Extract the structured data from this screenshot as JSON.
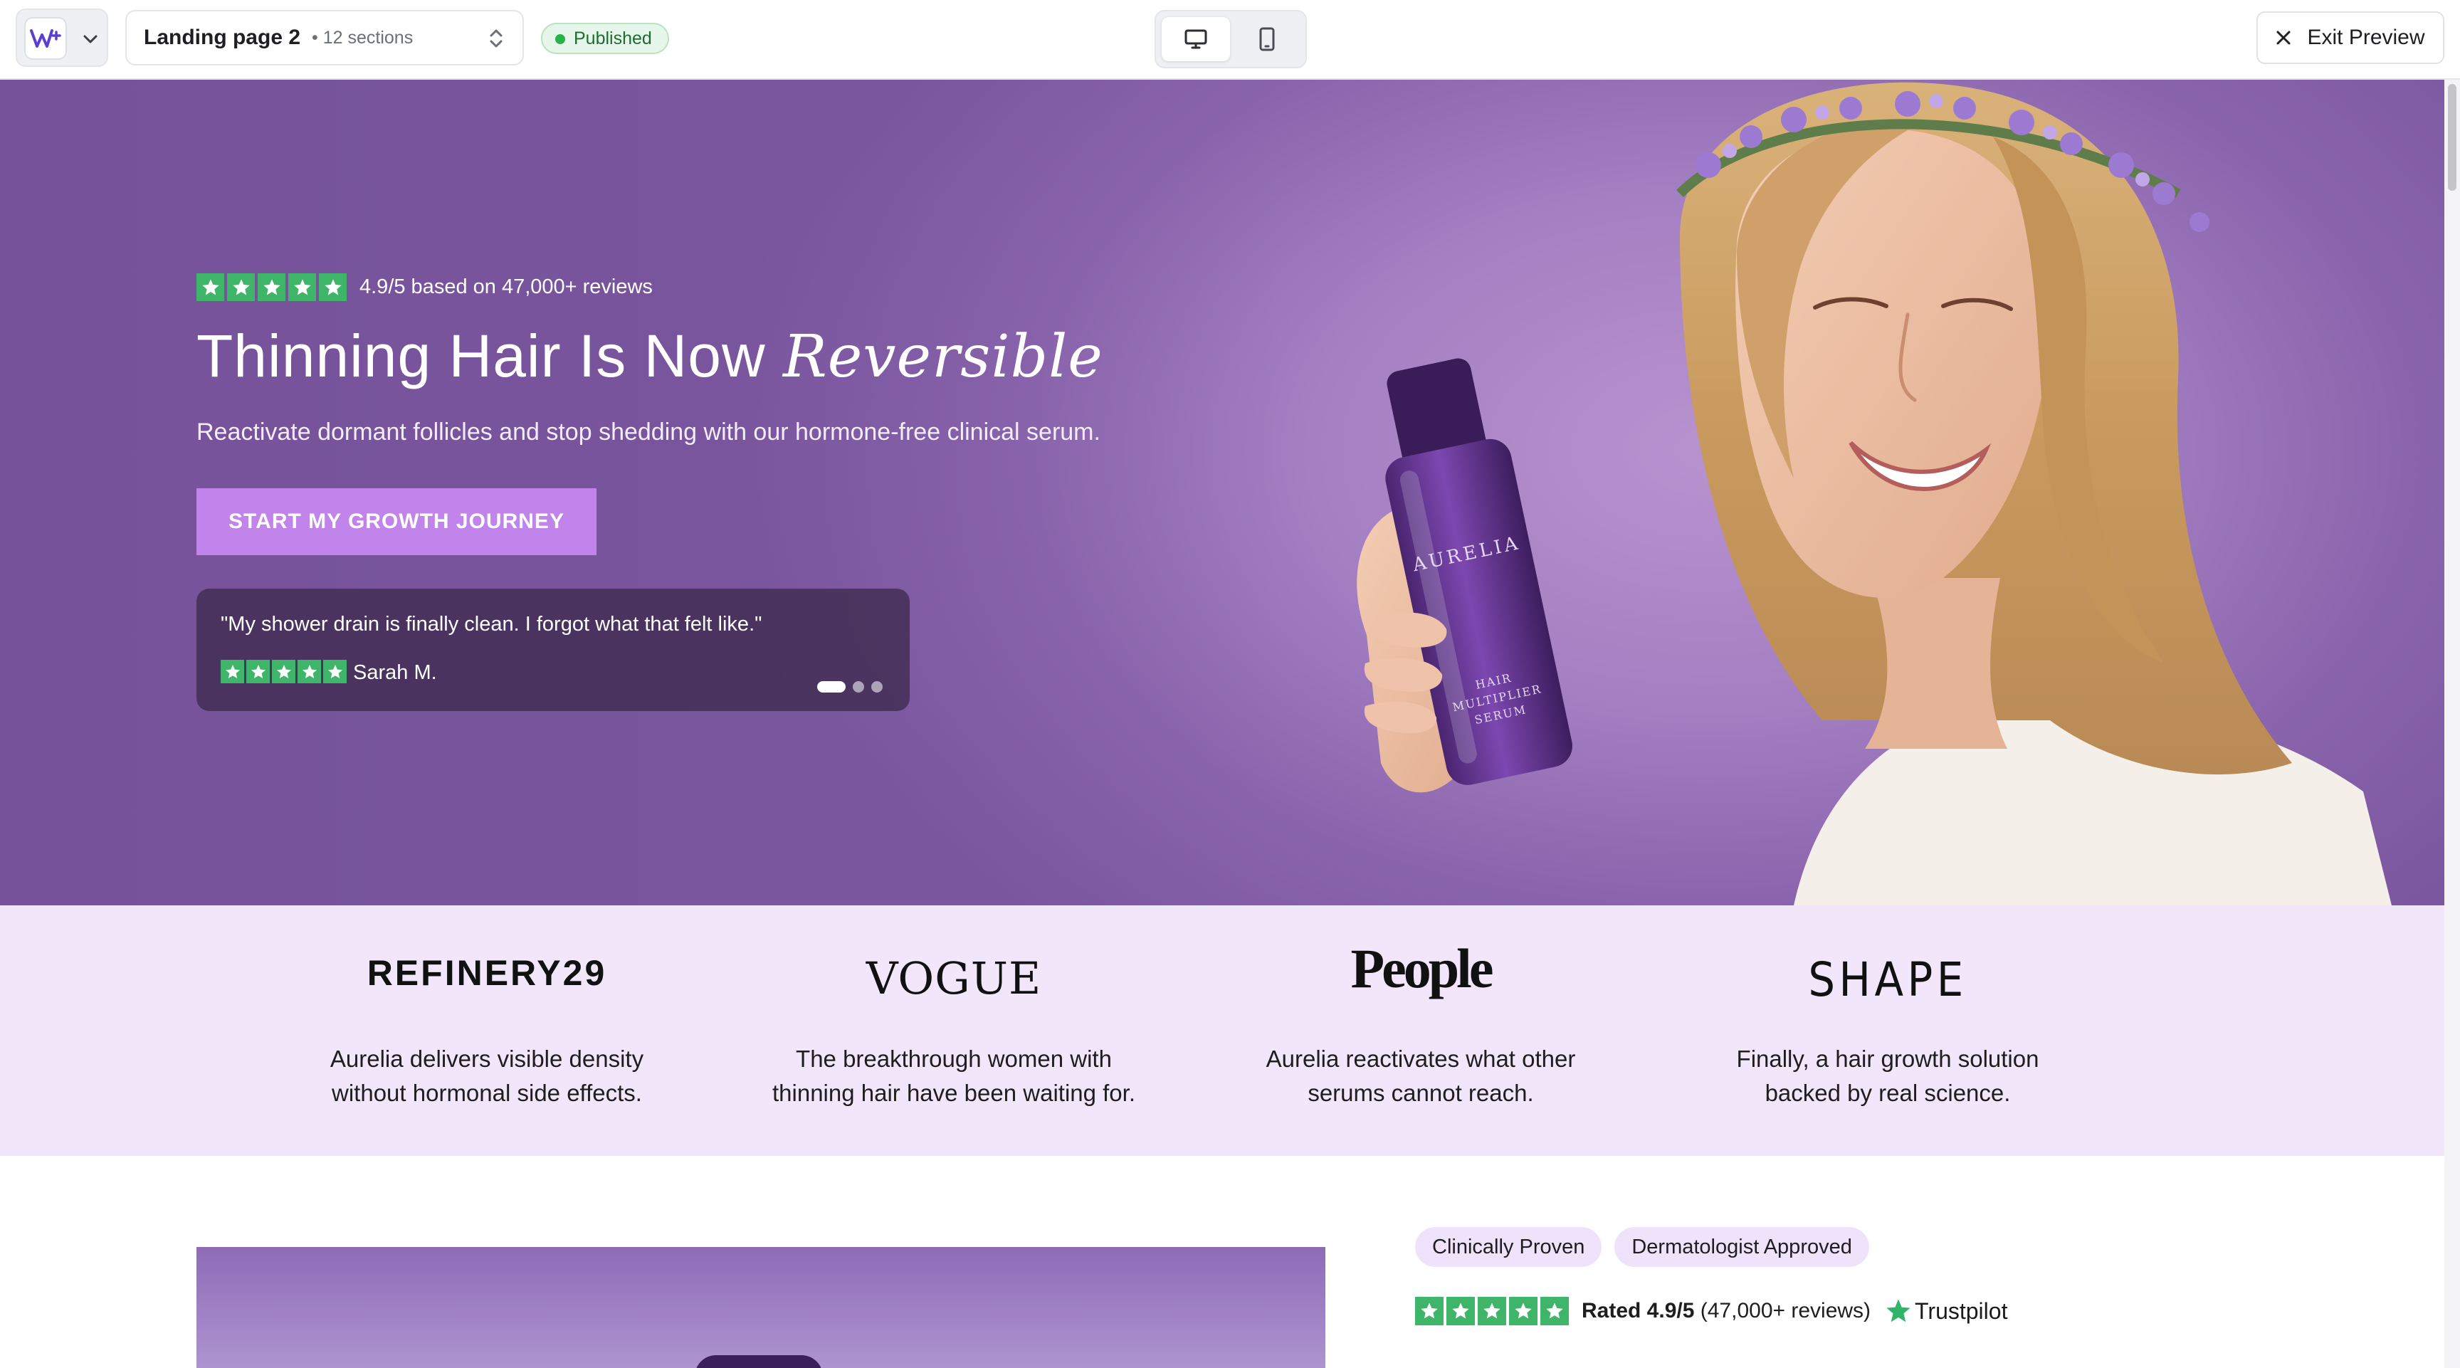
{
  "editor": {
    "page_name": "Landing page 2",
    "sections_count": "• 12 sections",
    "status": "Published",
    "exit_label": "Exit Preview",
    "devices": [
      "desktop-icon",
      "mobile-icon"
    ],
    "active_device": "desktop"
  },
  "hero": {
    "rating_text": "4.9/5 based on 47,000+ reviews",
    "title_main": "Thinning Hair Is Now ",
    "title_accent": "Reversible",
    "subtitle": "Reactivate dormant follicles and stop shedding with our hormone-free clinical serum.",
    "cta_label": "START MY GROWTH JOURNEY",
    "testimonial": {
      "quote": "\"My shower drain is finally clean. I forgot what that felt like.\"",
      "author": "Sarah M.",
      "slide_count": 3,
      "active_slide": 1
    },
    "product_brand": "AURELIA",
    "product_label_1": "HAIR",
    "product_label_2": "MULTIPLIER",
    "product_label_3": "SERUM"
  },
  "press": [
    {
      "logo": "REFINERY29",
      "quote_1": "Aurelia delivers visible density",
      "quote_2": "without hormonal side effects."
    },
    {
      "logo": "VOGUE",
      "quote_1": "The breakthrough women with",
      "quote_2": "thinning hair have been waiting for."
    },
    {
      "logo": "People",
      "quote_1": "Aurelia reactivates what other",
      "quote_2": "serums cannot reach."
    },
    {
      "logo": "SHAPE",
      "quote_1": "Finally, a hair growth solution",
      "quote_2": "backed by real science."
    }
  ],
  "lower": {
    "tags": [
      "Clinically Proven",
      "Dermatologist Approved"
    ],
    "rated_bold": "Rated 4.9/5",
    "rated_rest": " (47,000+ reviews)",
    "trustpilot": "Trustpilot"
  },
  "colors": {
    "hero_bg": "#8a65ad",
    "cta": "#c184ea",
    "star_green": "#3fb56a",
    "press_bg": "#f2e6fb",
    "tag_bg": "#efe3fb",
    "published_green": "#27b24a"
  }
}
